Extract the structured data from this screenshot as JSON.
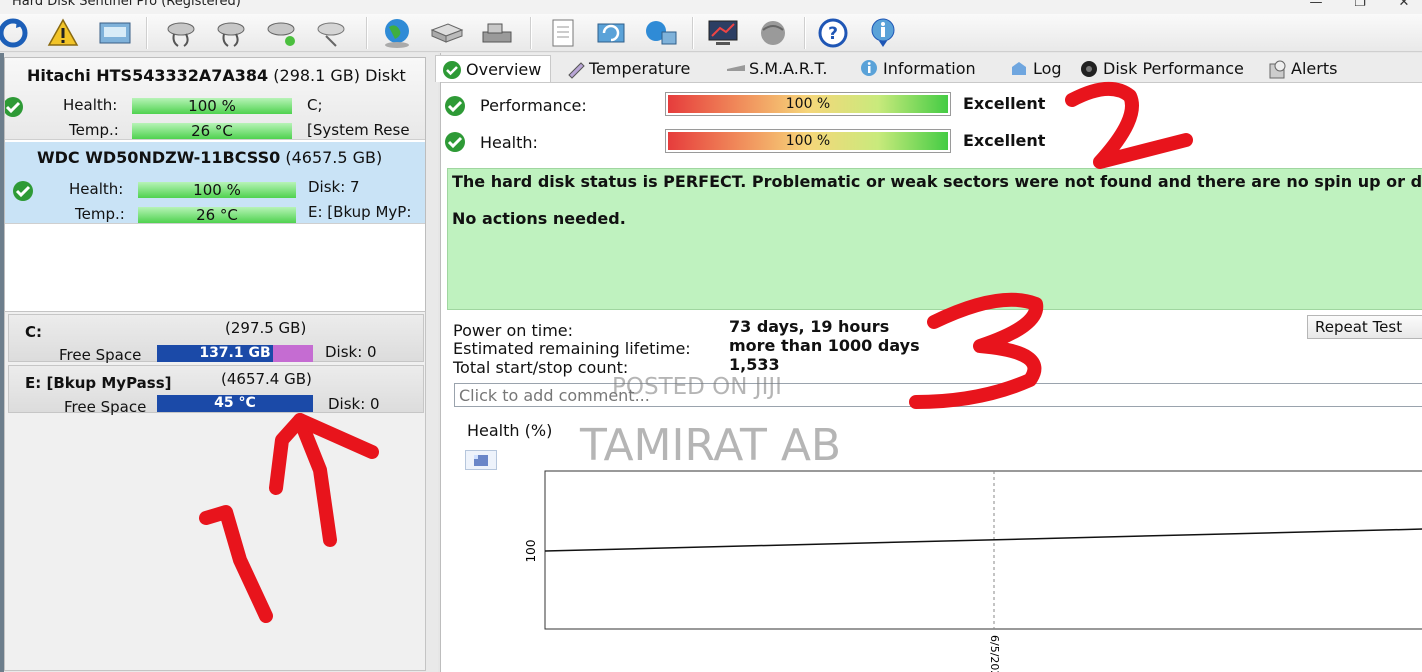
{
  "window": {
    "title": "Hard Disk Sentinel Pro (Registered)",
    "minimize": "—",
    "maximize": "❐",
    "close": "✕"
  },
  "toolbar": {
    "icons": [
      "refresh-icon",
      "warning-icon",
      "disk-report-icon",
      "disk-test-icon",
      "disk-check-icon",
      "disk-tool-icon",
      "disk-erase-icon",
      "globe-icon",
      "hdd-icon",
      "drive-icon",
      "document-icon",
      "refresh-disk-icon",
      "network-icon",
      "monitor-icon",
      "web-icon",
      "help-icon",
      "info-icon"
    ]
  },
  "disks": [
    {
      "model": "Hitachi HTS543332A7A384",
      "size": "(298.1 GB)",
      "extra": "Diskt",
      "health_label": "Health:",
      "health": "100 %",
      "temp_label": "Temp.:",
      "temp": "26 °C",
      "side1": "C;",
      "side2": "[System Rese"
    },
    {
      "model": "WDC WD50NDZW-11BCSS0",
      "size": "(4657.5 GB)",
      "health_label": "Health:",
      "health": "100 %",
      "temp_label": "Temp.:",
      "temp": "26 °C",
      "side1": "Disk: 7",
      "side2": "E: [Bkup MyP:"
    }
  ],
  "volumes": [
    {
      "name": "C:",
      "size": "(297.5 GB)",
      "free_label": "Free Space",
      "free": "137.1 GB",
      "disk": "Disk: 0"
    },
    {
      "name": "E: [Bkup MyPass]",
      "size": "(4657.4 GB)",
      "free_label": "Free Space",
      "free": "45 °C",
      "disk": "Disk: 0"
    }
  ],
  "tabs": [
    "Overview",
    "Temperature",
    "S.M.A.R.T.",
    "Information",
    "Log",
    "Disk Performance",
    "Alerts"
  ],
  "overview": {
    "performance_label": "Performance:",
    "performance_value": "100 %",
    "performance_rating": "Excellent",
    "health_label": "Health:",
    "health_value": "100 %",
    "health_rating": "Excellent",
    "status_line1": "The hard disk status is PERFECT. Problematic or weak sectors were not found and there are no spin up or data transfer e",
    "status_line2": "No actions needed.",
    "power_on_label": "Power on time:",
    "power_on_value": "73 days, 19 hours",
    "lifetime_label": "Estimated remaining lifetime:",
    "lifetime_value": "more than 1000 days",
    "startstop_label": "Total start/stop count:",
    "startstop_value": "1,533",
    "repeat_button": "Repeat Test",
    "comment_placeholder": "Click to add comment..."
  },
  "chart_data": {
    "type": "line",
    "title": "Health (%)",
    "ylabel": "",
    "xlabel": "",
    "y_ticks": [
      "100"
    ],
    "x_ticks": [
      "6/5/2025"
    ],
    "series": [
      {
        "values": [
          100,
          100
        ]
      }
    ]
  },
  "watermarks": {
    "posted": "POSTED ON JIJI",
    "author": "TAMIRAT AB"
  },
  "annotations": {
    "mark1": "11",
    "mark2": "2",
    "mark3": "3"
  },
  "colors": {
    "accent_blue": "#1b4aa8",
    "health_green": "#4fd24f",
    "status_bg": "#bff2bf",
    "annotation_red": "#e8141c"
  }
}
